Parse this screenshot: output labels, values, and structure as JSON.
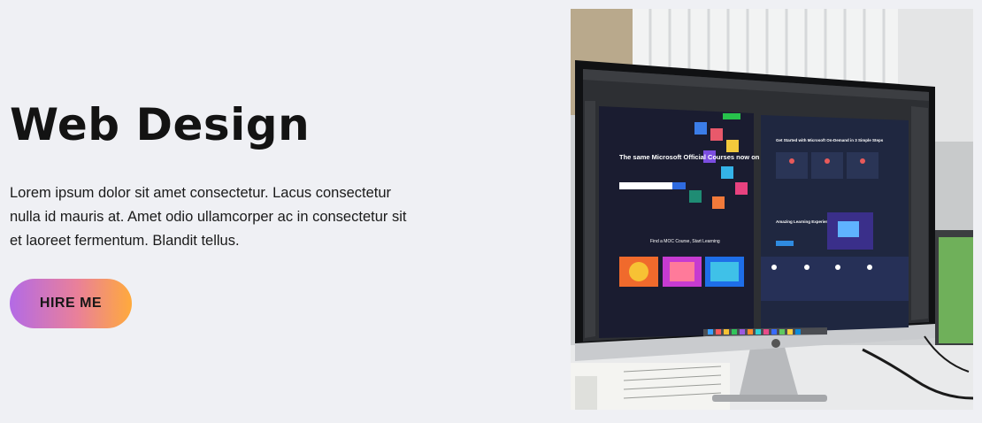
{
  "hero": {
    "title": "Web Design",
    "description": "Lorem ipsum dolor sit amet consectetur. Lacus consectetur nulla id mauris at. Amet odio ullamcorper ac in consectetur sit et laoreet fermentum. Blandit tellus.",
    "button_label": "HIRE ME"
  },
  "photo": {
    "screen_headline": "The same Microsoft Official Courses now on your schedule, on-demand",
    "screen_subheading": "Find a MOC Course, Start Learning",
    "screen_right_heading": "Get Started with Microsoft On-Demand in 3 Simple Steps",
    "screen_right_section": "Amazing Learning Experience"
  },
  "colors": {
    "background": "#eff0f4",
    "title": "#131313",
    "button_gradient_start": "#b36ae6",
    "button_gradient_end": "#ffaa3c"
  }
}
